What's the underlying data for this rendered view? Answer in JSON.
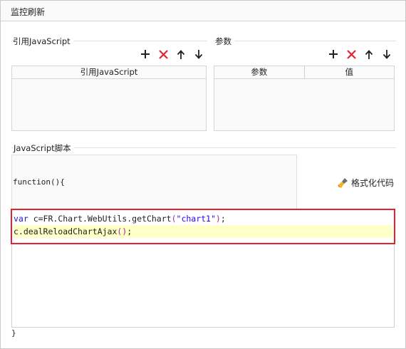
{
  "window": {
    "title": "监控刷新"
  },
  "js_refs": {
    "section_label": "引用JavaScript",
    "toolbar": [
      "add-icon",
      "delete-icon",
      "move-up-icon",
      "move-down-icon"
    ],
    "columns": [
      "引用JavaScript"
    ],
    "rows": []
  },
  "params": {
    "section_label": "参数",
    "toolbar": [
      "add-icon",
      "delete-icon",
      "move-up-icon",
      "move-down-icon"
    ],
    "columns": [
      "参数",
      "值"
    ],
    "rows": []
  },
  "script": {
    "section_label": "JavaScript脚本",
    "function_header": "function(){",
    "format_button_label": "格式化代码",
    "code_lines": [
      {
        "keyword": "var",
        "text_a": " c=FR.Chart.WebUtils.getChart",
        "paren_open": "(",
        "string": "\"chart1\"",
        "paren_close": ")",
        "tail": ";"
      },
      {
        "text": "c.dealReloadChartAjax",
        "parens": "()",
        "tail": ";"
      }
    ],
    "closing_brace": "}"
  },
  "colors": {
    "delete_red": "#e4222d",
    "highlight_frame": "#e4222d",
    "current_line_bg": "#ffffc8",
    "keyword": "#1d14c8",
    "string": "#2a00ff",
    "paren": "#b21f9e"
  }
}
